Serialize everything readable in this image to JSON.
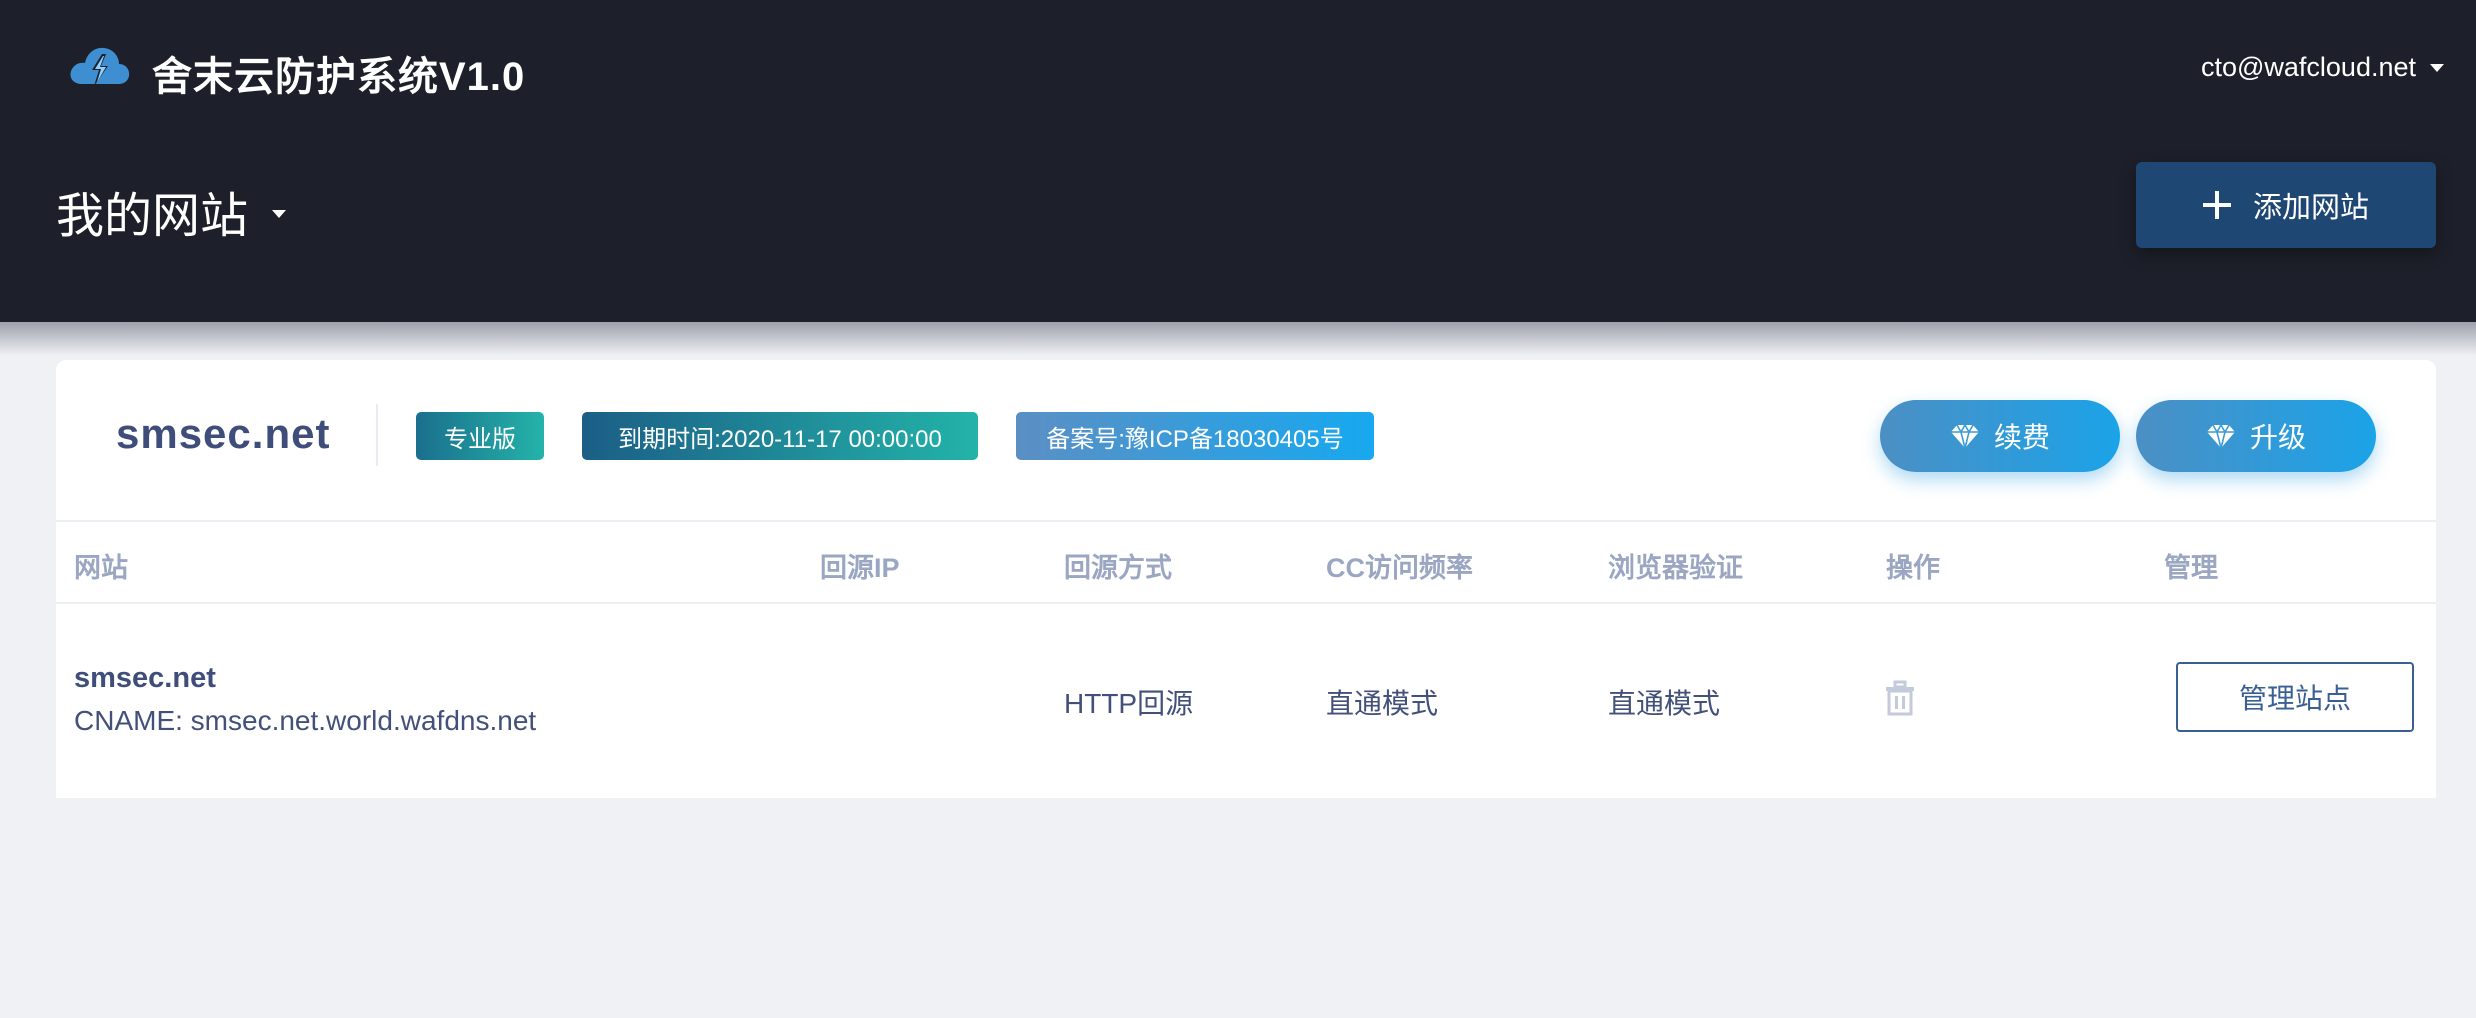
{
  "app": {
    "title": "舍末云防护系统V1.0",
    "user_email": "cto@wafcloud.net",
    "logo_icon": "cloud-lightning-icon"
  },
  "page": {
    "site_switch_label": "我的网站",
    "add_site_label": "添加网站"
  },
  "site": {
    "name": "smsec.net",
    "plan_badge": "专业版",
    "expire_badge": "到期时间:2020-11-17 00:00:00",
    "icp_badge": "备案号:豫ICP备18030405号",
    "renew_label": "续费",
    "upgrade_label": "升级"
  },
  "table": {
    "headers": [
      "网站",
      "回源IP",
      "回源方式",
      "CC访问频率",
      "浏览器验证",
      "操作",
      "管理"
    ],
    "rows": [
      {
        "site": "smsec.net",
        "cname": "CNAME:  smsec.net.world.wafdns.net",
        "origin_ip": "",
        "origin_mode": "HTTP回源",
        "cc_rate": "直通模式",
        "browser_check": "直通模式",
        "manage_label": "管理站点"
      }
    ]
  },
  "colors": {
    "header_bg": "#1d202a",
    "page_bg": "#eff1f5",
    "accent_blue": "#1ba3e8",
    "add_button": "#1f4774",
    "text_primary": "#3f4d7a",
    "text_muted": "#9aa6c2"
  }
}
